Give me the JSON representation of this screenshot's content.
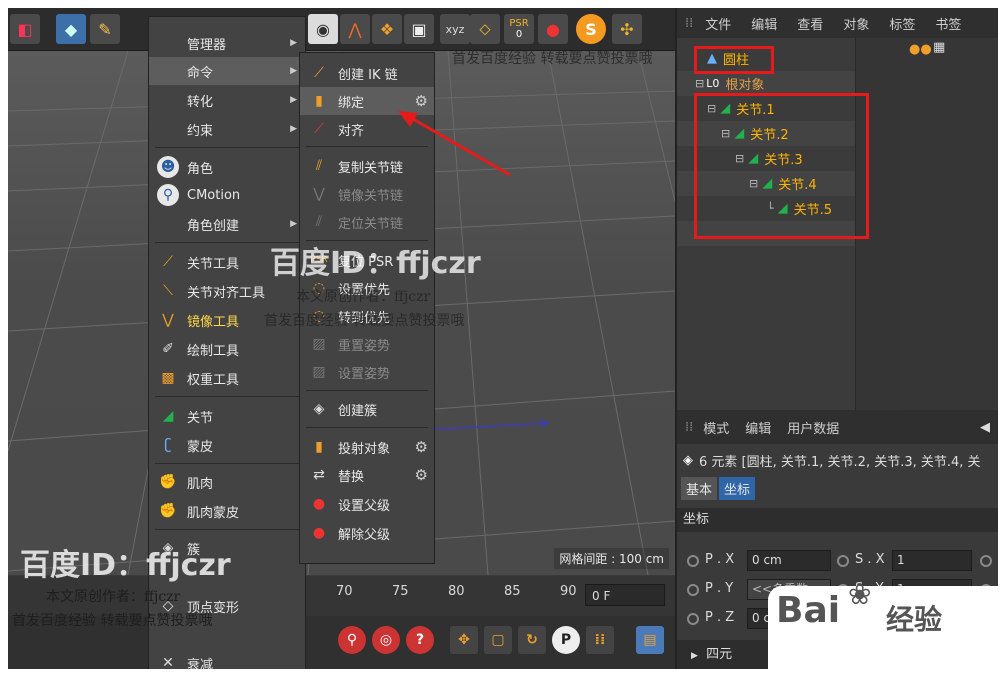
{
  "colors": {
    "accent_red": "#e51b1b",
    "selection_blue": "#2f66a8",
    "joint_green": "#22b14c",
    "label_orange": "#ffb400"
  },
  "object_manager": {
    "menu": [
      "文件",
      "编辑",
      "查看",
      "对象",
      "标签",
      "书签"
    ],
    "tree": [
      {
        "label": "圆柱",
        "icon": "cylinder-icon"
      },
      {
        "label": "根对象",
        "icon": "null-object-icon"
      },
      {
        "label": "关节.1",
        "icon": "joint-icon"
      },
      {
        "label": "关节.2",
        "icon": "joint-icon"
      },
      {
        "label": "关节.3",
        "icon": "joint-icon"
      },
      {
        "label": "关节.4",
        "icon": "joint-icon"
      },
      {
        "label": "关节.5",
        "icon": "joint-icon"
      }
    ]
  },
  "attribute_manager": {
    "menu": [
      "模式",
      "编辑",
      "用户数据"
    ],
    "info": "6 元素 [圆柱, 关节.1, 关节.2, 关节.3, 关节.4, 关",
    "tabs": [
      "基本",
      "坐标"
    ],
    "section": "坐标",
    "fields": [
      {
        "label": "P . X",
        "value": "0 cm",
        "label2": "S . X",
        "value2": "1"
      },
      {
        "label": "P . Y",
        "value": "<<多重数",
        "label2": "S . Y",
        "value2": "1"
      },
      {
        "label": "P . Z",
        "value": "0 cm",
        "label2": "",
        "value2": ""
      }
    ],
    "collapsed_section": "四元"
  },
  "menu_level1": [
    {
      "label": "管理器",
      "submenu": true,
      "icon": ""
    },
    {
      "label": "命令",
      "submenu": true,
      "icon": "",
      "highlighted": true
    },
    {
      "label": "转化",
      "submenu": true,
      "icon": ""
    },
    {
      "label": "约束",
      "submenu": true,
      "icon": ""
    },
    {
      "label": "角色",
      "icon": "character-icon"
    },
    {
      "label": "CMotion",
      "icon": "cmotion-icon"
    },
    {
      "label": "角色创建",
      "submenu": true,
      "icon": ""
    },
    {
      "label": "关节工具",
      "icon": "joint-tool-icon"
    },
    {
      "label": "关节对齐工具",
      "icon": "joint-align-icon"
    },
    {
      "label": "镜像工具",
      "icon": "mirror-tool-icon",
      "emphasis": true
    },
    {
      "label": "绘制工具",
      "icon": "paint-tool-icon"
    },
    {
      "label": "权重工具",
      "icon": "weight-tool-icon"
    },
    {
      "label": "关节",
      "icon": "joint-icon"
    },
    {
      "label": "蒙皮",
      "icon": "skin-icon"
    },
    {
      "label": "肌肉",
      "icon": "muscle-icon"
    },
    {
      "label": "肌肉蒙皮",
      "icon": "muscle-skin-icon"
    },
    {
      "label": "簇",
      "icon": "cluster-icon"
    },
    {
      "label": "顶点变形",
      "icon": "vertex-deform-icon"
    },
    {
      "label": "衰减",
      "icon": "falloff-icon"
    }
  ],
  "menu_level2": [
    {
      "label": "创建 IK 链",
      "icon": "ik-chain-icon"
    },
    {
      "label": "绑定",
      "icon": "bind-icon",
      "highlighted": true,
      "gear": true
    },
    {
      "label": "对齐",
      "icon": "align-icon"
    },
    {
      "label": "复制关节链",
      "icon": "copy-chain-icon"
    },
    {
      "label": "镜像关节链",
      "icon": "mirror-chain-icon",
      "disabled": true
    },
    {
      "label": "定位关节链",
      "icon": "position-chain-icon",
      "disabled": true
    },
    {
      "label": "复位 PSR",
      "icon": "reset-psr-icon"
    },
    {
      "label": "设置优先",
      "icon": "set-priority-icon"
    },
    {
      "label": "转到优先",
      "icon": "goto-priority-icon"
    },
    {
      "label": "重置姿势",
      "icon": "reset-pose-icon",
      "disabled": true
    },
    {
      "label": "设置姿势",
      "icon": "set-pose-icon",
      "disabled": true
    },
    {
      "label": "创建簇",
      "icon": "create-cluster-icon"
    },
    {
      "label": "投射对象",
      "icon": "project-object-icon",
      "gear": true
    },
    {
      "label": "替换",
      "icon": "replace-icon",
      "gear": true
    },
    {
      "label": "设置父级",
      "icon": "set-parent-icon"
    },
    {
      "label": "解除父级",
      "icon": "unparent-icon"
    }
  ],
  "viewport": {
    "grid_spacing": "网格间距 : 100 cm"
  },
  "timeline": {
    "ticks": [
      "70",
      "75",
      "80",
      "85",
      "90"
    ],
    "frame": "0 F"
  },
  "toolbar": {
    "psr_label": "PSR",
    "psr_value": "0"
  },
  "watermarks": {
    "baidu_id": "百度ID：ffjczr",
    "author": "本文原创作者：ffjczr",
    "notice": "首发百度经验 转载要点赞投票哦",
    "baidu_logo": "Bai",
    "experience": "经验"
  }
}
